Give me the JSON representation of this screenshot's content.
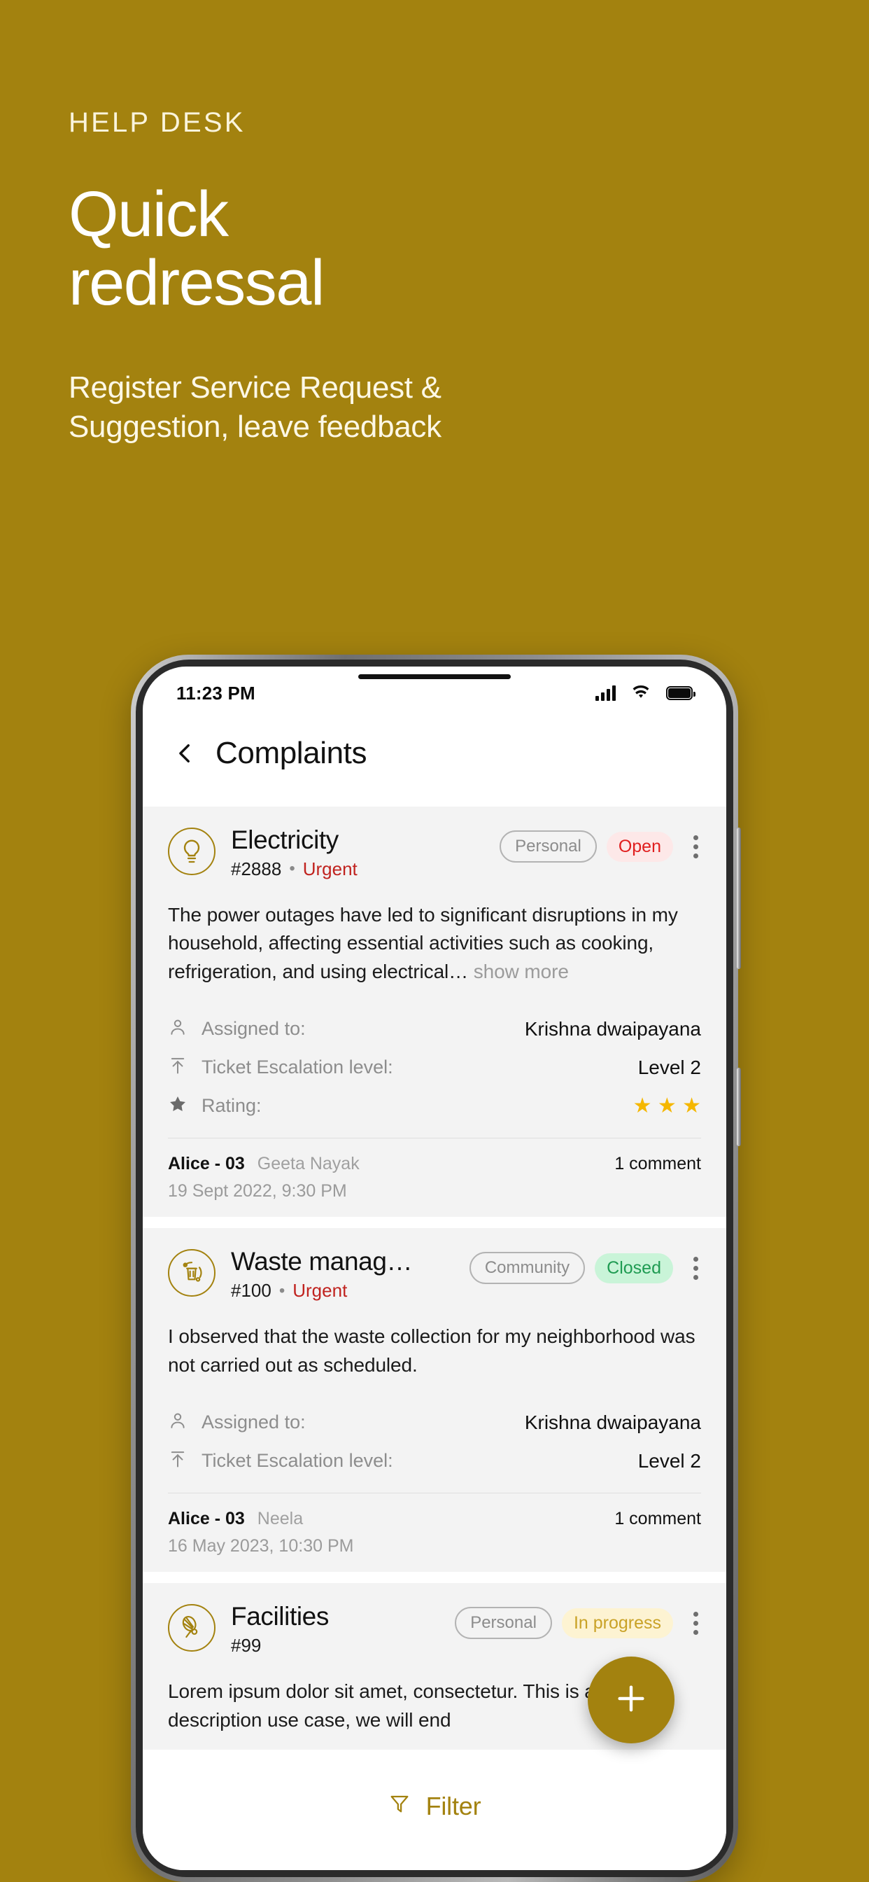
{
  "promo": {
    "eyebrow": "HELP DESK",
    "headline_line1": "Quick",
    "headline_line2": "redressal",
    "subhead_line1": "Register Service Request &",
    "subhead_line2": "Suggestion, leave feedback",
    "brand_color": "#a3820f"
  },
  "status_bar": {
    "time": "11:23 PM",
    "signal_icon": "cellular-signal-icon",
    "wifi_icon": "wifi-icon",
    "battery_icon": "battery-full-icon"
  },
  "app_bar": {
    "back_icon": "back-chevron-icon",
    "title": "Complaints"
  },
  "complaints": [
    {
      "icon": "lightbulb-icon",
      "category": "Electricity",
      "ticket_id": "#2888",
      "separator": "•",
      "priority": "Urgent",
      "scope_chip": "Personal",
      "status": "Open",
      "status_kind": "open",
      "status_color": "#e01e1e",
      "status_bg": "#fde8e8",
      "menu_icon": "kebab-menu-icon",
      "description": "The power outages have led to significant disruptions in my household, affecting essential activities such as cooking, refrigeration, and using electrical…",
      "show_more": "show more",
      "meta": [
        {
          "icon": "person-icon",
          "label": "Assigned to:",
          "value": "Krishna dwaipayana",
          "type": "text"
        },
        {
          "icon": "escalation-arrow-icon",
          "label": "Ticket Escalation level:",
          "value": "Level 2",
          "type": "text"
        },
        {
          "icon": "star-icon",
          "label": "Rating:",
          "value": "★ ★ ★",
          "type": "stars",
          "stars": 3
        }
      ],
      "unit": "Alice - 03",
      "reporter": "Geeta Nayak",
      "comments": "1 comment",
      "timestamp": "19 Sept 2022, 9:30 PM"
    },
    {
      "icon": "waste-bin-recycle-icon",
      "category": "Waste manag…",
      "ticket_id": "#100",
      "separator": "•",
      "priority": "Urgent",
      "scope_chip": "Community",
      "status": "Closed",
      "status_kind": "closed",
      "status_color": "#1f9b52",
      "status_bg": "#c9f4d8",
      "menu_icon": "kebab-menu-icon",
      "description": "I observed that the waste collection for my neighborhood was not carried out as scheduled.",
      "show_more": "",
      "meta": [
        {
          "icon": "person-icon",
          "label": "Assigned to:",
          "value": "Krishna dwaipayana",
          "type": "text"
        },
        {
          "icon": "escalation-arrow-icon",
          "label": "Ticket Escalation level:",
          "value": "Level 2",
          "type": "text"
        }
      ],
      "unit": "Alice - 03",
      "reporter": "Neela",
      "comments": "1 comment",
      "timestamp": "16 May 2023, 10:30 PM"
    },
    {
      "icon": "tennis-racket-icon",
      "category": "Facilities",
      "ticket_id": "#99",
      "separator": "",
      "priority": "",
      "scope_chip": "Personal",
      "status": "In progress",
      "status_kind": "inprogress",
      "status_color": "#c9a227",
      "status_bg": "#fdf3d2",
      "menu_icon": "kebab-menu-icon",
      "description": "Lorem ipsum dolor sit amet, consectetur. This is a two line description use case, we will end",
      "show_more": "",
      "meta": [],
      "unit": "",
      "reporter": "",
      "comments": "",
      "timestamp": ""
    }
  ],
  "fab": {
    "icon": "plus-icon",
    "label": "Add complaint",
    "color": "#a3820f"
  },
  "filter_bar": {
    "icon": "funnel-filter-icon",
    "label": "Filter",
    "color": "#a3820f"
  }
}
